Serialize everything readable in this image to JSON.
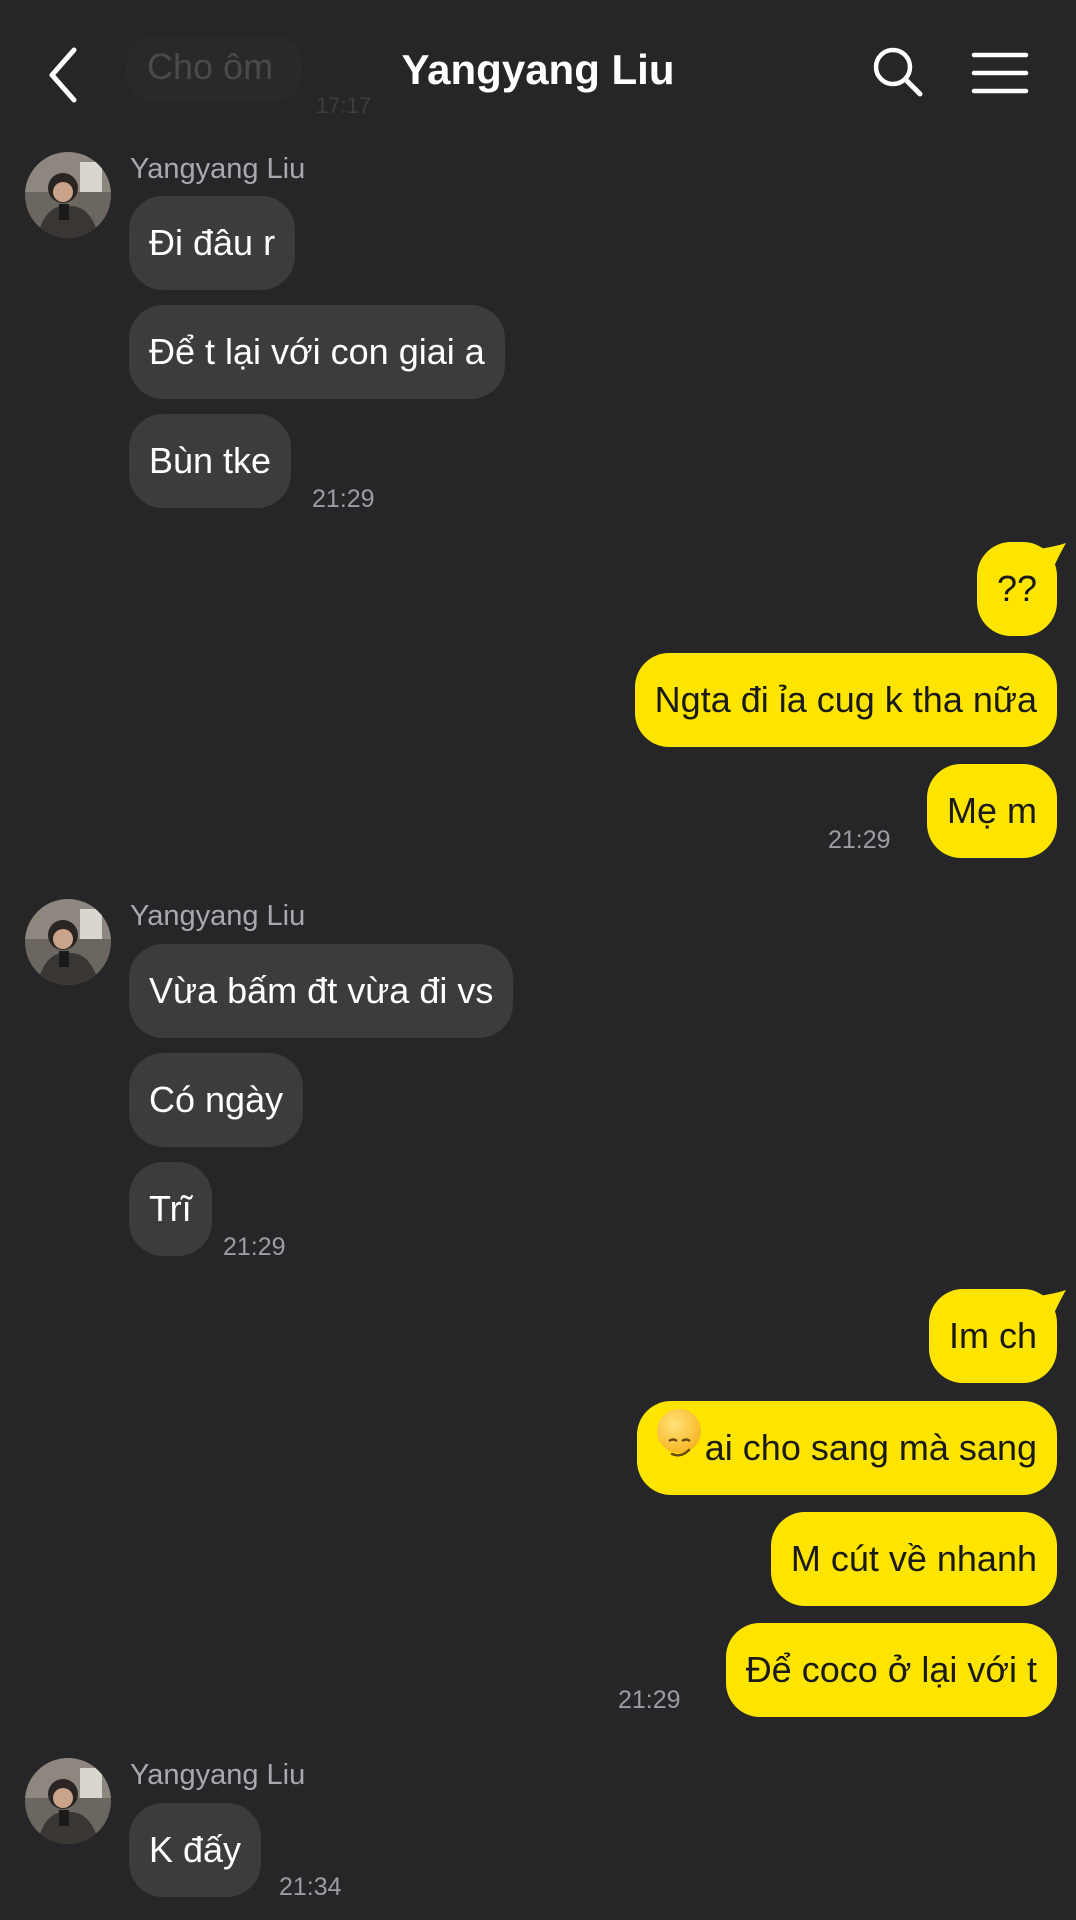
{
  "header": {
    "title": "Yangyang Liu",
    "ghost_message": "Cho ôm",
    "ghost_time": "17:17"
  },
  "colors": {
    "background": "#262628",
    "incoming_bubble": "#3c3c3f",
    "outgoing_bubble": "#fee500"
  },
  "icons": {
    "back": "chevron-left-icon",
    "search": "search-icon",
    "menu": "hamburger-menu-icon",
    "emoji": "smirking-face-icon"
  },
  "groups": [
    {
      "sender": "Yangyang Liu",
      "messages": [
        "Đi đâu r",
        "Để t lại với con giai a",
        "Bùn tke"
      ],
      "time": "21:29"
    },
    {
      "messages": [
        "??",
        "Ngta đi ỉa cug k tha nữa",
        "Mẹ m"
      ],
      "time": "21:29"
    },
    {
      "sender": "Yangyang Liu",
      "messages": [
        "Vừa bấm đt vừa đi vs",
        "Có ngày",
        "Trĩ"
      ],
      "time": "21:29"
    },
    {
      "messages": [
        "Im ch",
        "ai cho sang mà sang",
        "M cút về nhanh",
        "Để coco ở lại với t"
      ],
      "time": "21:29"
    },
    {
      "sender": "Yangyang Liu",
      "messages": [
        "K đấy"
      ],
      "time": "21:34"
    }
  ]
}
